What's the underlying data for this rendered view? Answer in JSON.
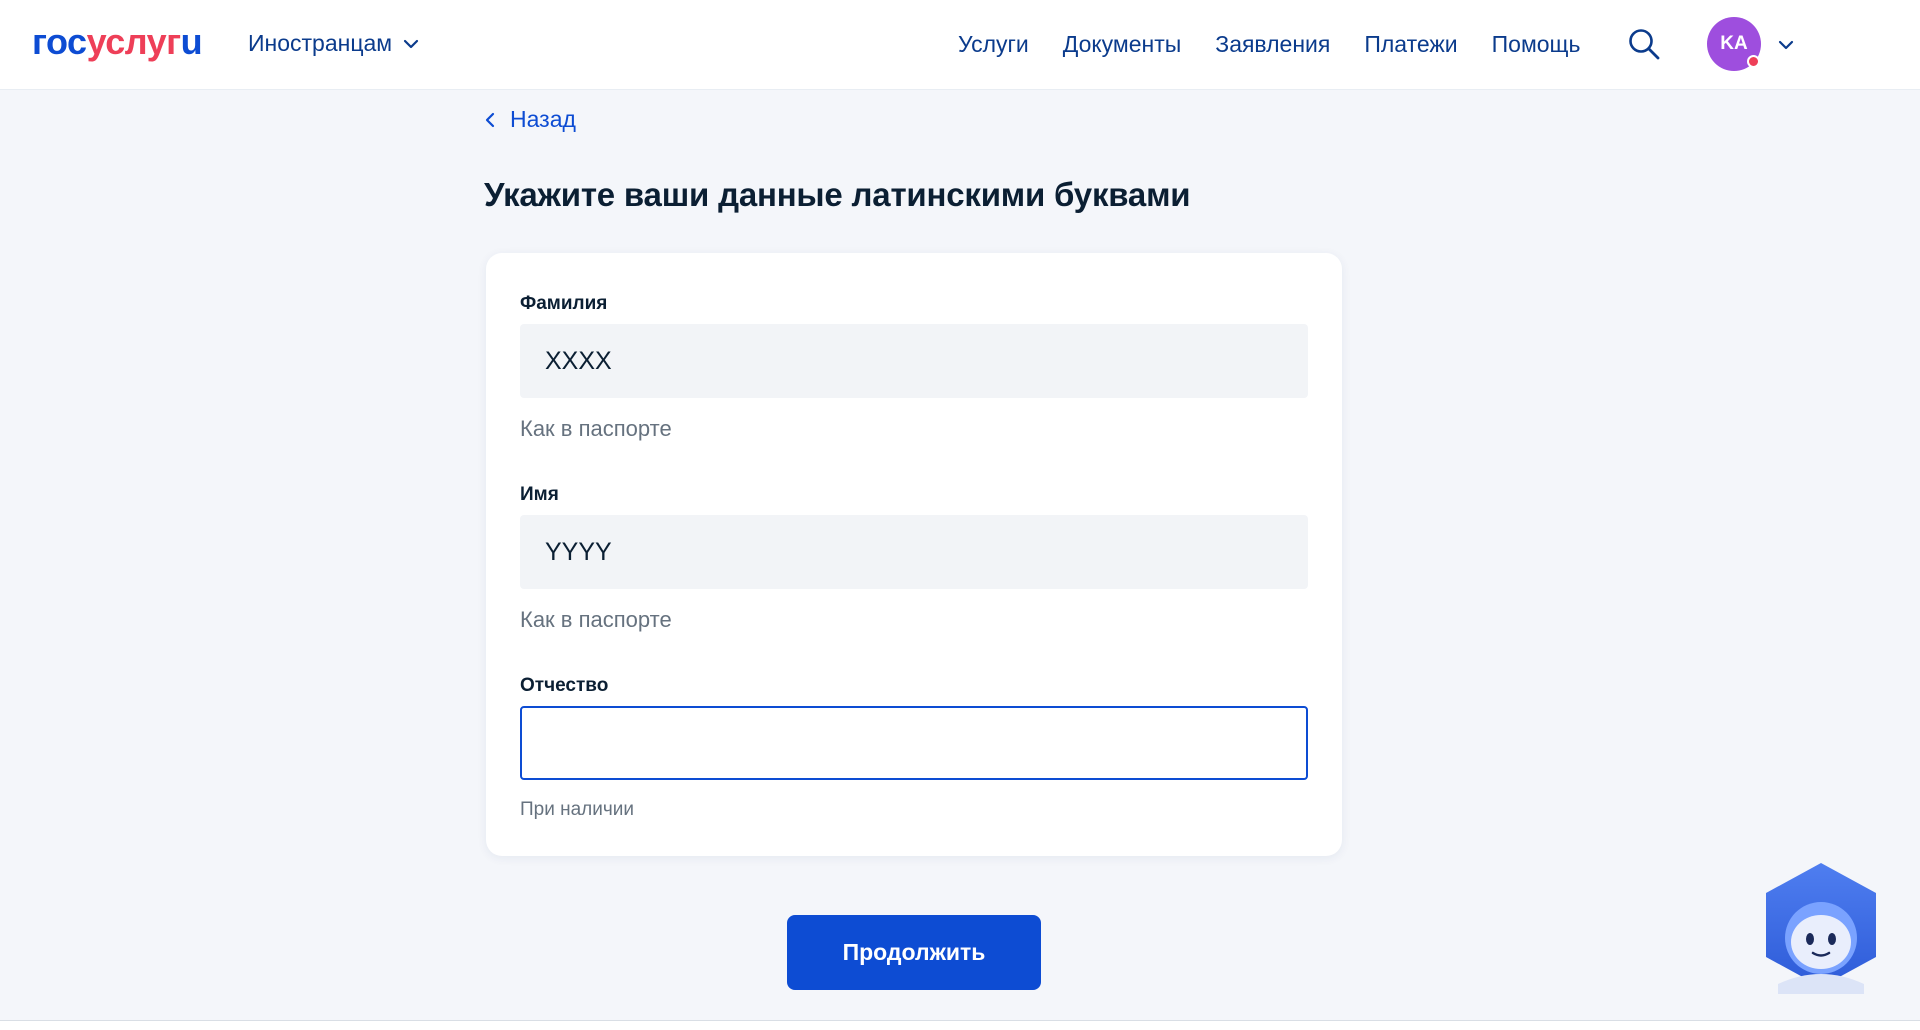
{
  "header": {
    "logo": {
      "part1": "гос",
      "part2": "услуг",
      "part3": "u"
    },
    "audience_label": "Иностранцам",
    "nav": [
      "Услуги",
      "Документы",
      "Заявления",
      "Платежи",
      "Помощь"
    ],
    "avatar_initials": "KA"
  },
  "back_label": "Назад",
  "page_title": "Укажите ваши данные латинскими буквами",
  "form": {
    "last_name": {
      "label": "Фамилия",
      "value": "XXXX",
      "hint": "Как в паспорте"
    },
    "first_name": {
      "label": "Имя",
      "value": "YYYY",
      "hint": "Как в паспорте"
    },
    "patronymic": {
      "label": "Отчество",
      "value": "",
      "hint": "При наличии"
    }
  },
  "continue_label": "Продолжить",
  "colors": {
    "primary": "#0d4cd3",
    "logo_accent": "#ee3f58",
    "avatar_bg": "#9e4ede",
    "nav_text": "#0b3b8c"
  }
}
